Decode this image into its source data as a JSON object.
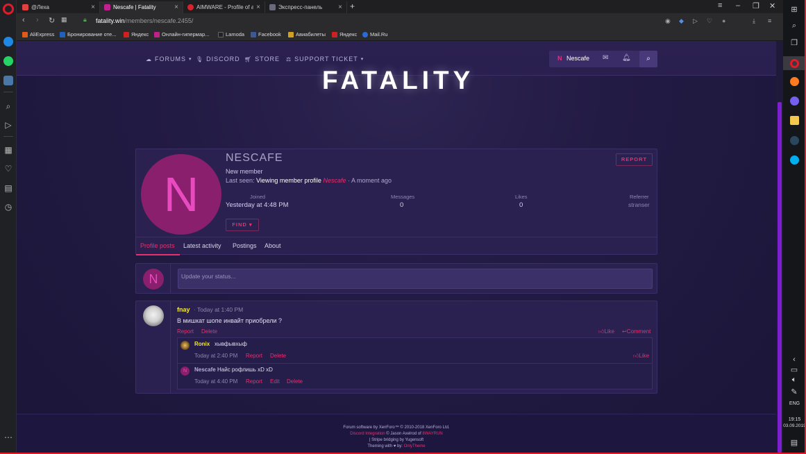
{
  "browser": {
    "tabs": [
      {
        "label": "@Леха",
        "color": "#e04040"
      },
      {
        "label": "Nescafe | Fatality",
        "color": "#c0218f"
      },
      {
        "label": "AIMWARE - Profile of aimw",
        "color": "#d9232b"
      },
      {
        "label": "Экспресс-панель",
        "color": "#6a6a7a"
      }
    ],
    "url_host": "fatality.win",
    "url_path": "/members/nescafe.2455/",
    "bookmarks": [
      {
        "label": "AliExpress",
        "color": "#e05a1a"
      },
      {
        "label": "Бронирование оте...",
        "color": "#2060c0"
      },
      {
        "label": "Яндекс",
        "color": "#d02020"
      },
      {
        "label": "Онлайн-гипермар...",
        "color": "#c0208a"
      },
      {
        "label": "Lamoda",
        "color": "#222222"
      },
      {
        "label": "Facebook",
        "color": "#3b5998"
      },
      {
        "label": "Авиабилеты",
        "color": "#d0a020"
      },
      {
        "label": "Яндекс",
        "color": "#d02020"
      },
      {
        "label": "Mail.Ru",
        "color": "#2a6bd8"
      }
    ]
  },
  "nav": {
    "forums": "FORUMS",
    "discord": "DISCORD",
    "store": "STORE",
    "support": "SUPPORT TICKET",
    "user_initial": "N",
    "user_name": "Nescafe"
  },
  "logo": "FATALITY",
  "profile": {
    "initial": "N",
    "name": "NESCAFE",
    "role": "New member",
    "last_seen_prefix": "Last seen:",
    "last_seen_activity": "Viewing member profile",
    "last_seen_name": "Nescafe",
    "last_seen_time": "· A moment ago",
    "report": "REPORT",
    "find": "FIND ▾",
    "stats": {
      "joined_label": "Joined",
      "joined_value": "Yesterday at 4:48 PM",
      "messages_label": "Messages",
      "messages_value": "0",
      "likes_label": "Likes",
      "likes_value": "0",
      "referrer_label": "Referrer",
      "referrer_value": "stranser"
    },
    "tabs": [
      "Profile posts",
      "Latest activity",
      "Postings",
      "About"
    ]
  },
  "status": {
    "placeholder": "Update your status..."
  },
  "post": {
    "user": "fnay",
    "time": "· Today at 1:40 PM",
    "text": "В мишкат шопе инвайт приобрели ?",
    "report": "Report",
    "delete": "Delete",
    "like": "Like",
    "comment": "Comment",
    "comments": [
      {
        "user": "Ronix",
        "user_color": "#f4e83a",
        "text": "хывфывхыф",
        "time": "Today at 2:40 PM",
        "actions": [
          "Report",
          "Delete"
        ],
        "like": "Like"
      },
      {
        "user": "Nescafe",
        "user_color": "#b8b0d8",
        "text": "Найс рофлишь xD xD",
        "time": "Today at 4:40 PM",
        "actions": [
          "Report",
          "Edit",
          "Delete"
        ]
      }
    ]
  },
  "footer": {
    "line1": "Forum software by XenForo™ © 2010-2018 XenForo Ltd.",
    "line2_link": "Discord Integration",
    "line2_rest": "© Jason Axelrod of",
    "line2_brand": "8WAYRUN",
    "line3": "| Stripe bridging by Yugensoft",
    "line4_prefix": "Theming with",
    "line4_by": "by:",
    "line4_brand": "OnlyTheme"
  },
  "taskbar": {
    "lang": "ENG",
    "time": "19:15",
    "date": "03.09.2019"
  },
  "colors": {
    "accent": "#e8306c",
    "opera_red": "#e21b2a",
    "scroll_thumb": "#7d1ed1"
  }
}
